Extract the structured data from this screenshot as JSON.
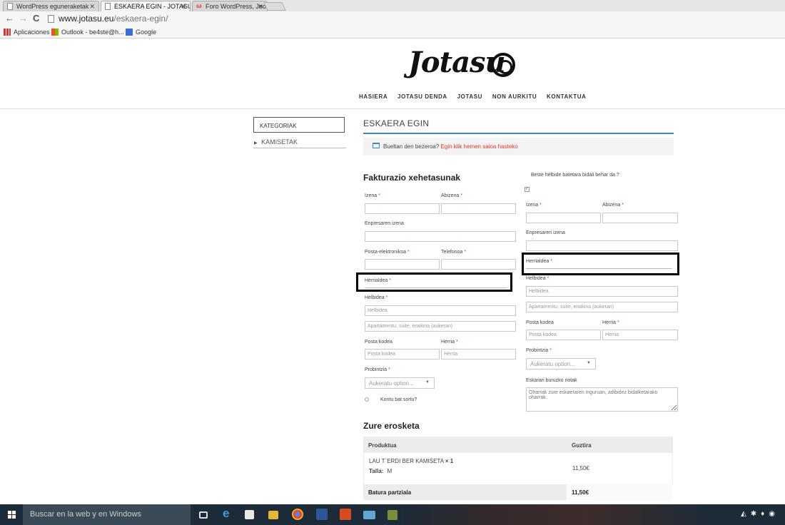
{
  "browser": {
    "tabs": [
      {
        "title": "WordPress eguneraketak",
        "active": false
      },
      {
        "title": "ESKAERA EGIN - JOTASU",
        "active": true
      },
      {
        "title": "Foro WordPress, Joomla y",
        "active": false
      }
    ],
    "url_host": "www.jotasu.eu",
    "url_path": "/eskaera-egin/",
    "bookmarks": [
      "Aplicaciones",
      "Outlook - be4ste@h...",
      "Google"
    ]
  },
  "site": {
    "logo_text": "Jotasu",
    "nav": [
      "HASIERA",
      "JOTASU DENDA",
      "JOTASU",
      "NON AURKITU",
      "KONTAKTUA"
    ]
  },
  "sidebar": {
    "heading": "KATEGORIAK",
    "items": [
      "KAMISETAK"
    ]
  },
  "page": {
    "title": "ESKAERA EGIN",
    "notice_text": "Bueltan den bezeroa?",
    "notice_link": "Egin klik hemen saioa hasteko"
  },
  "billing": {
    "heading": "Fakturazio xehetasunak",
    "first_name_label": "Izena",
    "last_name_label": "Abizena",
    "company_label": "Enpresaren izena",
    "email_label": "Posta-elektronikoa",
    "phone_label": "Telefonoa",
    "country_label": "Herrialdea",
    "address_label": "Helbidea",
    "address1_placeholder": "Helbidea",
    "address2_placeholder": "Apartamentu, suite, eraikina (aukeran)",
    "postcode_label": "Posta kodea",
    "postcode_placeholder": "Posta kodea",
    "city_label": "Herria",
    "city_placeholder": "Herria",
    "state_label": "Probintzia",
    "state_value": "Aukeratu option...",
    "create_account_label": "Kontu bat sortu?"
  },
  "shipping": {
    "question": "Beste helbide batetara bidali behar da ?",
    "checkbox_mark": "✓",
    "first_name_label": "Izena",
    "last_name_label": "Abizena",
    "company_label": "Enpresaren izena",
    "country_label": "Herrialdea",
    "address_label": "Helbidea",
    "address1_placeholder": "Helbidea",
    "address2_placeholder": "Apartamentu, suite, eraikina (aukeran)",
    "postcode_label": "Posta kodea",
    "postcode_placeholder": "Posta kodea",
    "city_label": "Herria",
    "city_placeholder": "Herria",
    "state_label": "Probintzia",
    "state_value": "Aukeratu option...",
    "notes_label": "Eskarari buruzko notak",
    "notes_placeholder": "Oharrak zure eskaeraren inguruan, adibidez bidalketarako oharrak."
  },
  "order": {
    "heading": "Zure erosketa",
    "col_product": "Produktua",
    "col_total": "Guztira",
    "items": [
      {
        "name": "LAU T`ERDI BER KAMISETA",
        "qty": "× 1",
        "meta_label": "Talla:",
        "meta_value": "M",
        "total": "11,50€"
      }
    ],
    "subtotal_label": "Batura partziala",
    "subtotal_value": "11,50€"
  },
  "taskbar": {
    "search_placeholder": "Buscar en la web y en Windows"
  },
  "required_mark": "*"
}
